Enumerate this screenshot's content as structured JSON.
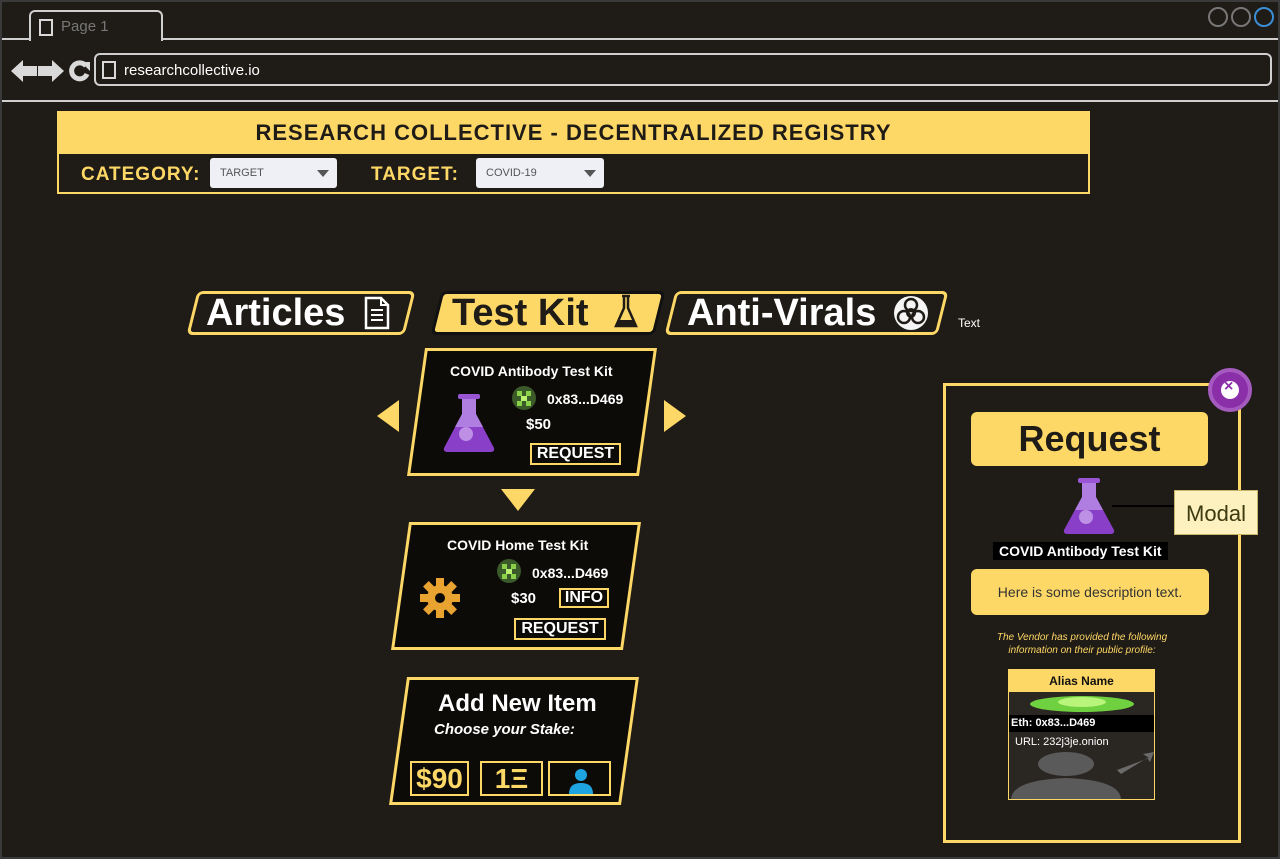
{
  "browser": {
    "tab_title": "Page 1",
    "url": "researchcollective.io"
  },
  "registry": {
    "title": "RESEARCH COLLECTIVE - DECENTRALIZED REGISTRY",
    "category_label": "CATEGORY:",
    "category_value": "TARGET",
    "target_label": "TARGET:",
    "target_value": "COVID-19"
  },
  "tabs": [
    {
      "label": "Articles",
      "icon": "document-icon",
      "active": false
    },
    {
      "label": "Test Kit",
      "icon": "flask-icon",
      "active": true
    },
    {
      "label": "Anti-Virals",
      "icon": "biohazard-icon",
      "active": false
    }
  ],
  "extra_text": "Text",
  "items": [
    {
      "name": "COVID Antibody Test Kit",
      "vendor": "0x83...D469",
      "price": "$50",
      "request_label": "REQUEST",
      "icon": "flask-icon"
    },
    {
      "name": "COVID Home Test Kit",
      "vendor": "0x83...D469",
      "price": "$30",
      "info_label": "INFO",
      "request_label": "REQUEST",
      "icon": "gear-icon"
    }
  ],
  "add_item": {
    "title": "Add New Item",
    "subtitle": "Choose your Stake:",
    "stake_usd": "$90",
    "stake_eth": "1Ξ"
  },
  "modal": {
    "title": "Request",
    "item_name": "COVID Antibody Test Kit",
    "description": "Here is some description text.",
    "vendor_note": "The Vendor has provided the following information on their public profile:",
    "profile": {
      "alias": "Alias Name",
      "eth": "Eth: 0x83...D469",
      "url": "URL: 232j3je.onion"
    },
    "callout": "Modal"
  },
  "colors": {
    "accent": "#fed866",
    "background": "#1f1b16",
    "flask": "#8a3fc8",
    "close": "#8a2fa8"
  }
}
